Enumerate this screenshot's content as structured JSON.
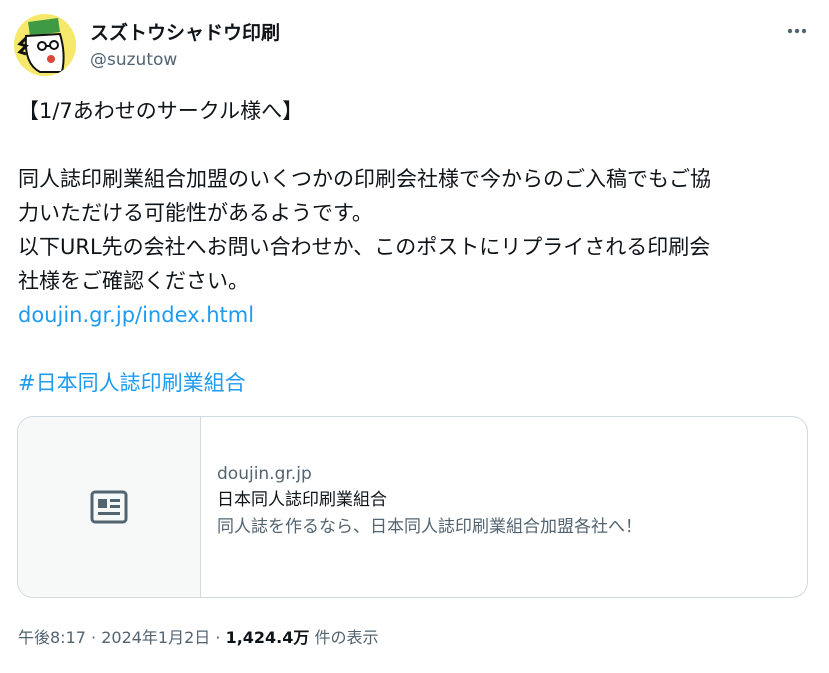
{
  "author": {
    "display_name": "スズトウシャドウ印刷",
    "handle": "@suzutow"
  },
  "tweet": {
    "lines": [
      "【1/7あわせのサークル様へ】",
      "",
      "同人誌印刷業組合加盟のいくつかの印刷会社様で今からのご入稿でもご協",
      "力いただける可能性があるようです。",
      "以下URL先の会社へお問い合わせか、このポストにリプライされる印刷会",
      "社様をご確認ください。"
    ],
    "link_text": "doujin.gr.jp/index.html",
    "hashtag": "#日本同人誌印刷業組合"
  },
  "card": {
    "domain": "doujin.gr.jp",
    "title": "日本同人誌印刷業組合",
    "description": "同人誌を作るなら、日本同人誌印刷業組合加盟各社へ！",
    "thumb_icon": "newspaper-icon"
  },
  "meta": {
    "time": "午後8:17",
    "separator": " · ",
    "date": "2024年1月2日",
    "views_count": "1,424.4万",
    "views_label": " 件の表示"
  },
  "colors": {
    "link": "#1d9bf0",
    "text": "#0f1419",
    "muted": "#536471",
    "border": "#cfd9de",
    "avatar_bg": "#f6e86a"
  }
}
